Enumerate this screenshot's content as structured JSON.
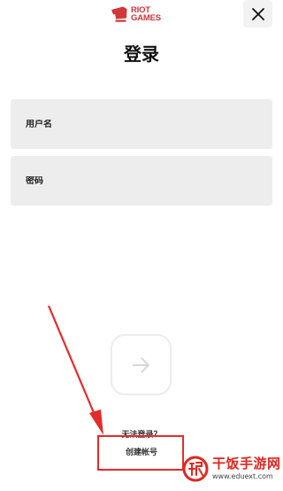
{
  "brand": {
    "logo_line1": "RIOT",
    "logo_line2": "GAMES",
    "color": "#d13639"
  },
  "header": {
    "close_icon": "close-icon"
  },
  "page": {
    "title": "登录"
  },
  "form": {
    "username_placeholder": "用户名",
    "username_value": "",
    "password_placeholder": "密码",
    "password_value": "",
    "submit_icon": "arrow-right-icon"
  },
  "links": {
    "cant_login": "无法登录？",
    "create_account": "创建帐号"
  },
  "annotation": {
    "color": "#e52a2a"
  },
  "watermark": {
    "title": "干饭手游网",
    "url": "www.eduext.com",
    "color": "#e0271f"
  }
}
